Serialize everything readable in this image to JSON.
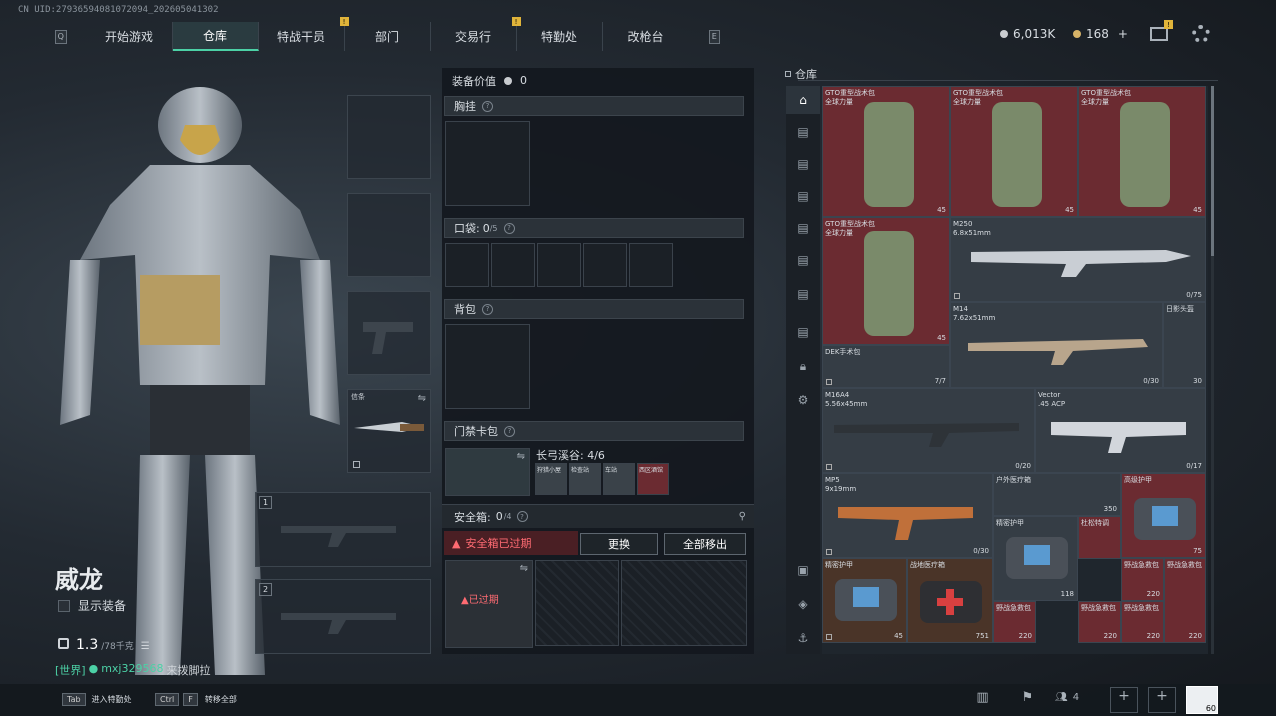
{
  "uid": "CN UID:27936594081072094_202605041302",
  "nav": {
    "left_key": "Q",
    "right_key": "E",
    "tabs": [
      {
        "label": "开始游戏",
        "active": false,
        "badge": false
      },
      {
        "label": "仓库",
        "active": true,
        "badge": false
      },
      {
        "label": "特战干员",
        "active": false,
        "badge": false
      },
      {
        "label": "部门",
        "active": false,
        "badge": true
      },
      {
        "label": "交易行",
        "active": false,
        "badge": false
      },
      {
        "label": "特勤处",
        "active": false,
        "badge": true
      },
      {
        "label": "改枪台",
        "active": false,
        "badge": false
      }
    ],
    "badge_text": "!"
  },
  "currency": {
    "silver": "6,013K",
    "gold": "168",
    "gold_add": "+"
  },
  "operator": {
    "name": "威龙",
    "show_equipment": "显示装备",
    "weight": "1.3",
    "weight_max": "/78千克",
    "chat_channel": "[世界]",
    "chat_user": "mxj32",
    "chat_user_tail": "9568",
    "chat_msg": "来拨脚拉"
  },
  "loadout": {
    "melee_label": "信条",
    "weapon_slot1_num": "1",
    "weapon_slot2_num": "2"
  },
  "equipment": {
    "value_label": "装备价值",
    "value": "0",
    "chest_label": "胸挂",
    "pocket_label": "口袋:",
    "pocket_used": "0",
    "pocket_max": "/5",
    "backpack_label": "背包",
    "keycard_label": "门禁卡包",
    "keycard_title": "长弓溪谷: 4/6",
    "keycard_names": [
      "狩猎小屋",
      "检查站",
      "车站",
      "西区酒馆"
    ],
    "safe_label": "安全箱:",
    "safe_used": "0",
    "safe_max": "/4",
    "safe_expired": "安全箱已过期",
    "change_button": "更换",
    "move_all_button": "全部移出",
    "expired_badge": "已过期"
  },
  "warehouse": {
    "title": "仓库",
    "items": [
      {
        "name": "GTO重型战术包\n全球力量",
        "count": "45"
      },
      {
        "name": "GTO重型战术包\n全球力量",
        "count": "45"
      },
      {
        "name": "GTO重型战术包\n全球力量",
        "count": "45"
      },
      {
        "name": "GTO重型战术包\n全球力量",
        "count": "45"
      },
      {
        "name": "M250\n6.8x51mm",
        "count": "0/75"
      },
      {
        "name": "M14\n7.62x51mm",
        "count": "0/30"
      },
      {
        "name": "日影头盔",
        "count": "30"
      },
      {
        "name": "DEK手术包",
        "count": "7/7"
      },
      {
        "name": "M16A4\n5.56x45mm",
        "count": "0/20"
      },
      {
        "name": "Vector\n.45 ACP",
        "count": "0/17"
      },
      {
        "name": "MP5\n9x19mm",
        "count": "0/30"
      },
      {
        "name": "户外医疗箱",
        "count": "350"
      },
      {
        "name": "高级护甲",
        "count": "75"
      },
      {
        "name": "精密护甲",
        "count": "118"
      },
      {
        "name": "杜松特调",
        "count": ""
      },
      {
        "name": "精密护甲",
        "count": "45"
      },
      {
        "name": "战地医疗箱",
        "count": "751"
      },
      {
        "name": "野战急救包",
        "count": "220"
      },
      {
        "name": "野战急救包",
        "count": "220"
      },
      {
        "name": "野战急救包",
        "count": "220"
      },
      {
        "name": "野战急救包",
        "count": "220"
      },
      {
        "name": "野战急救包",
        "count": "220"
      }
    ]
  },
  "bottom": {
    "tab_key": "Tab",
    "tab_action": "进入特勤处",
    "ctrl_key": "Ctrl",
    "f_key": "F",
    "ctrl_action": "转移全部",
    "squad_count": "4",
    "avatar_level": "60"
  },
  "colors": {
    "accent": "#4cd1a6",
    "red_alert": "#e0474f",
    "warehouse_red": "#6b2b31",
    "badge": "#e0b43a"
  }
}
